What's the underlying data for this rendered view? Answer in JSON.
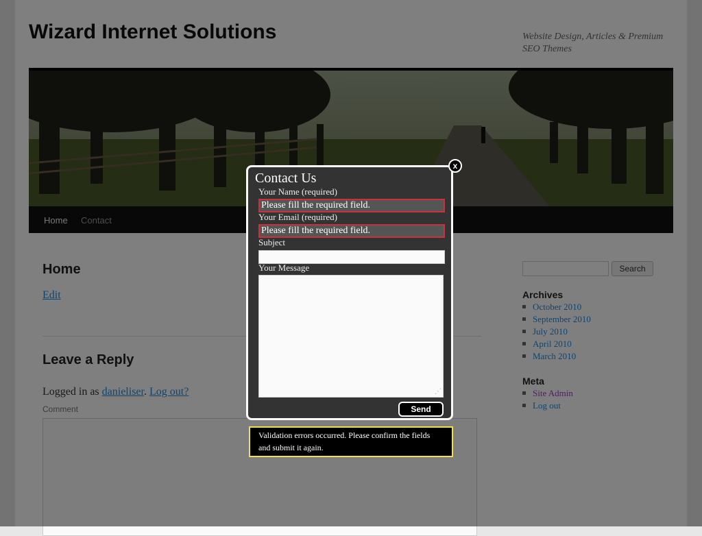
{
  "site": {
    "title": "Wizard Internet Solutions",
    "tagline": "Website Design, Articles & Premium SEO Themes"
  },
  "nav": {
    "items": [
      "Home",
      "Contact"
    ]
  },
  "main": {
    "heading": "Home",
    "edit_link": "Edit",
    "reply_heading": "Leave a Reply",
    "logged_in_prefix": "Logged in as ",
    "username": "danieliser",
    "logout_link": "Log out?",
    "comment_label": "Comment"
  },
  "sidebar": {
    "search_button": "Search",
    "archives_title": "Archives",
    "archives": [
      "October 2010",
      "September 2010",
      "July 2010",
      "April 2010",
      "March 2010"
    ],
    "meta_title": "Meta",
    "meta": [
      "Site Admin",
      "Log out"
    ]
  },
  "modal": {
    "title": "Contact Us",
    "name_label": "Your Name (required)",
    "name_error": "Please fill the required field.",
    "email_label": "Your Email (required)",
    "email_error": "Please fill the required field.",
    "subject_label": "Subject",
    "message_label": "Your Message",
    "send_label": "Send",
    "close_label": "x",
    "validation_message": "Validation errors occurred. Please confirm the fields and submit it again."
  },
  "colors": {
    "error_border": "#c9323b",
    "validation_border": "#f2e04a",
    "link": "#1b8be0"
  }
}
